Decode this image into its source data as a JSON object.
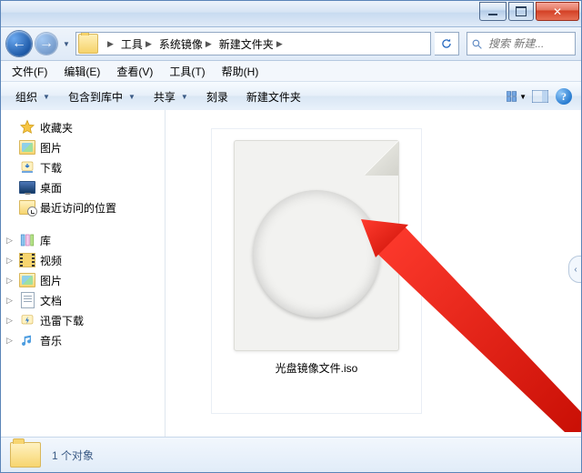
{
  "breadcrumb": {
    "segments": [
      "工具",
      "系统镜像",
      "新建文件夹"
    ]
  },
  "search": {
    "placeholder": "搜索 新建..."
  },
  "menubar": {
    "file": "文件(F)",
    "edit": "编辑(E)",
    "view": "查看(V)",
    "tools": "工具(T)",
    "help": "帮助(H)"
  },
  "toolbar": {
    "organize": "组织",
    "include": "包含到库中",
    "share": "共享",
    "burn": "刻录",
    "new_folder": "新建文件夹"
  },
  "sidebar": {
    "favorites": {
      "label": "收藏夹",
      "items": [
        {
          "key": "pictures",
          "label": "图片"
        },
        {
          "key": "downloads",
          "label": "下载"
        },
        {
          "key": "desktop",
          "label": "桌面"
        },
        {
          "key": "recent",
          "label": "最近访问的位置"
        }
      ]
    },
    "libraries": {
      "label": "库",
      "items": [
        {
          "key": "videos",
          "label": "视频"
        },
        {
          "key": "pictures",
          "label": "图片"
        },
        {
          "key": "documents",
          "label": "文档"
        },
        {
          "key": "thunder",
          "label": "迅雷下载"
        },
        {
          "key": "music",
          "label": "音乐"
        }
      ]
    }
  },
  "content": {
    "file_name": "光盘镜像文件.iso"
  },
  "statusbar": {
    "count_text": "1 个对象"
  }
}
